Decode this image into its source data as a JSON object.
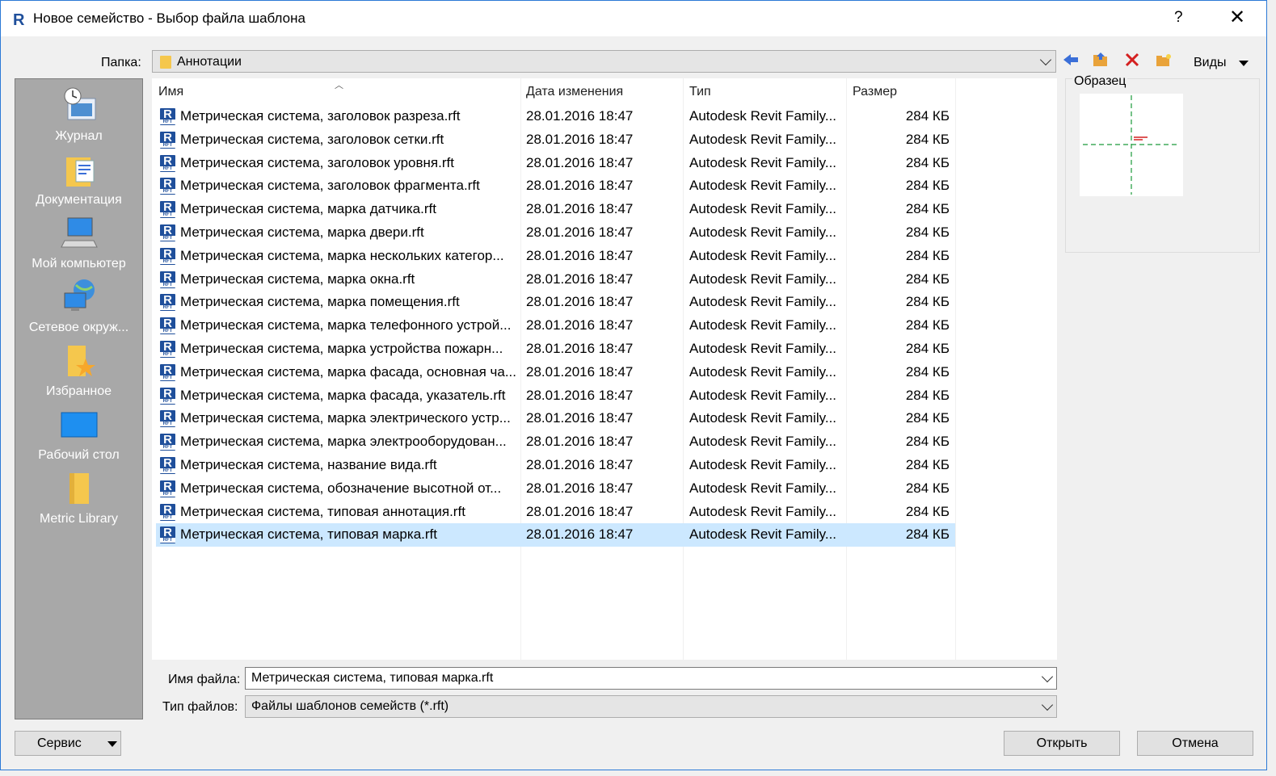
{
  "window": {
    "title": "Новое семейство - Выбор файла шаблона",
    "help": "?",
    "close": "✕"
  },
  "toolbar": {
    "folder_label": "Папка:",
    "folder_value": "Аннотации",
    "views_label": "Виды"
  },
  "places": [
    {
      "label": "Журнал",
      "icon": "history-icon"
    },
    {
      "label": "Документация",
      "icon": "documents-folder-icon"
    },
    {
      "label": "Мой компьютер",
      "icon": "computer-icon"
    },
    {
      "label": "Сетевое окруж...",
      "icon": "network-icon"
    },
    {
      "label": "Избранное",
      "icon": "favorites-folder-icon"
    },
    {
      "label": "Рабочий стол",
      "icon": "desktop-icon"
    },
    {
      "label": "Metric Library",
      "icon": "folder-icon"
    }
  ],
  "columns": {
    "name": "Имя",
    "date": "Дата изменения",
    "type": "Тип",
    "size": "Размер"
  },
  "files": [
    {
      "name": "Метрическая система, заголовок разреза.rft",
      "date": "28.01.2016 18:47",
      "type": "Autodesk Revit Family...",
      "size": "284 КБ"
    },
    {
      "name": "Метрическая система, заголовок сетки.rft",
      "date": "28.01.2016 18:47",
      "type": "Autodesk Revit Family...",
      "size": "284 КБ"
    },
    {
      "name": "Метрическая система, заголовок уровня.rft",
      "date": "28.01.2016 18:47",
      "type": "Autodesk Revit Family...",
      "size": "284 КБ"
    },
    {
      "name": "Метрическая система, заголовок фрагмента.rft",
      "date": "28.01.2016 18:47",
      "type": "Autodesk Revit Family...",
      "size": "284 КБ"
    },
    {
      "name": "Метрическая система, марка датчика.rft",
      "date": "28.01.2016 18:47",
      "type": "Autodesk Revit Family...",
      "size": "284 КБ"
    },
    {
      "name": "Метрическая система, марка двери.rft",
      "date": "28.01.2016 18:47",
      "type": "Autodesk Revit Family...",
      "size": "284 КБ"
    },
    {
      "name": "Метрическая система, марка нескольких категор...",
      "date": "28.01.2016 18:47",
      "type": "Autodesk Revit Family...",
      "size": "284 КБ"
    },
    {
      "name": "Метрическая система, марка окна.rft",
      "date": "28.01.2016 18:47",
      "type": "Autodesk Revit Family...",
      "size": "284 КБ"
    },
    {
      "name": "Метрическая система, марка помещения.rft",
      "date": "28.01.2016 18:47",
      "type": "Autodesk Revit Family...",
      "size": "284 КБ"
    },
    {
      "name": "Метрическая система, марка телефонного устрой...",
      "date": "28.01.2016 18:47",
      "type": "Autodesk Revit Family...",
      "size": "284 КБ"
    },
    {
      "name": "Метрическая система, марка устройства пожарн...",
      "date": "28.01.2016 18:47",
      "type": "Autodesk Revit Family...",
      "size": "284 КБ"
    },
    {
      "name": "Метрическая система, марка фасада, основная ча...",
      "date": "28.01.2016 18:47",
      "type": "Autodesk Revit Family...",
      "size": "284 КБ"
    },
    {
      "name": "Метрическая система, марка фасада, указатель.rft",
      "date": "28.01.2016 18:47",
      "type": "Autodesk Revit Family...",
      "size": "284 КБ"
    },
    {
      "name": "Метрическая система, марка электрического устр...",
      "date": "28.01.2016 18:47",
      "type": "Autodesk Revit Family...",
      "size": "284 КБ"
    },
    {
      "name": "Метрическая система, марка электрооборудован...",
      "date": "28.01.2016 18:47",
      "type": "Autodesk Revit Family...",
      "size": "284 КБ"
    },
    {
      "name": "Метрическая система, название вида.rft",
      "date": "28.01.2016 18:47",
      "type": "Autodesk Revit Family...",
      "size": "284 КБ"
    },
    {
      "name": "Метрическая система, обозначение высотной от...",
      "date": "28.01.2016 18:47",
      "type": "Autodesk Revit Family...",
      "size": "284 КБ"
    },
    {
      "name": "Метрическая система, типовая аннотация.rft",
      "date": "28.01.2016 18:47",
      "type": "Autodesk Revit Family...",
      "size": "284 КБ"
    },
    {
      "name": "Метрическая система, типовая марка.rft",
      "date": "28.01.2016 18:47",
      "type": "Autodesk Revit Family...",
      "size": "284 КБ",
      "selected": true
    }
  ],
  "preview": {
    "title": "Образец"
  },
  "form": {
    "filename_label": "Имя файла:",
    "filename_value": "Метрическая система, типовая марка.rft",
    "filetype_label": "Тип файлов:",
    "filetype_value": "Файлы шаблонов семейств  (*.rft)"
  },
  "buttons": {
    "service": "Сервис",
    "open": "Открыть",
    "cancel": "Отмена"
  },
  "colors": {
    "selection": "#cce8ff",
    "places_bg": "#a8a8a8",
    "revit_blue": "#1f4f9b"
  }
}
